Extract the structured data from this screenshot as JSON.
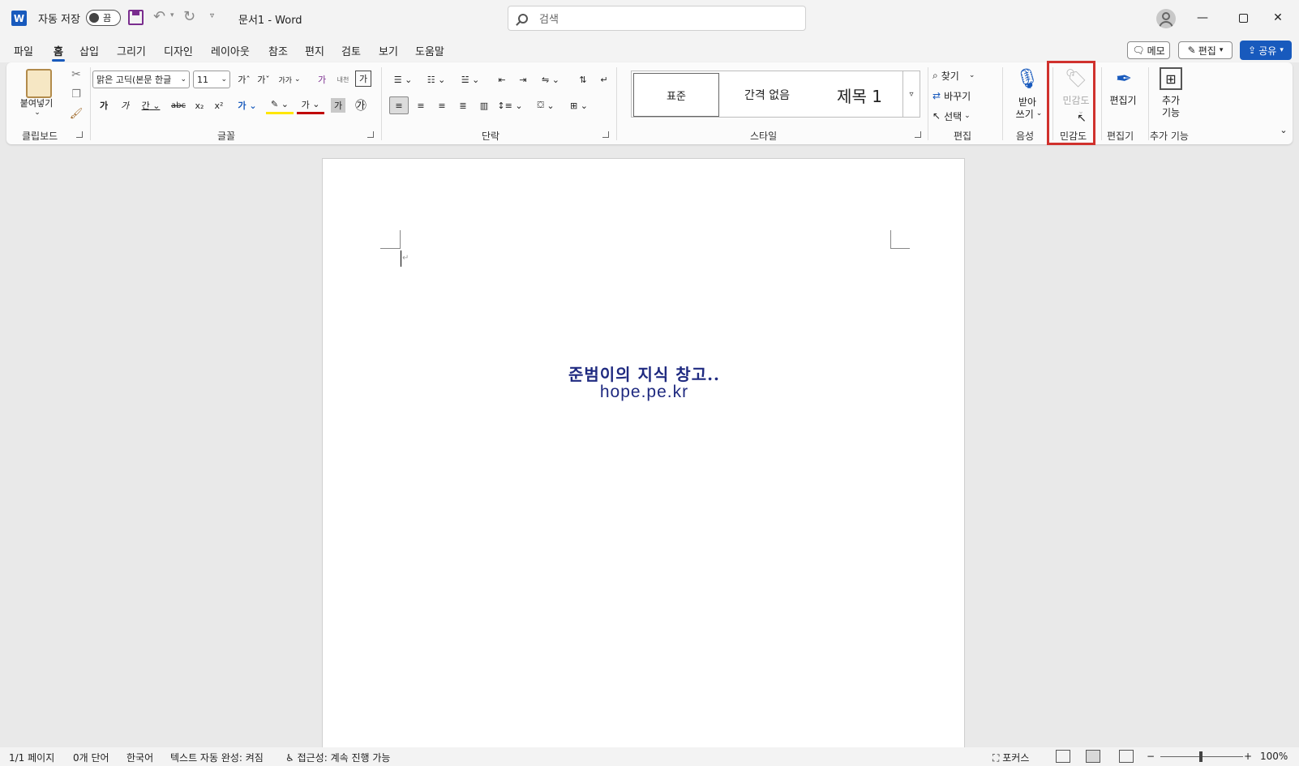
{
  "titlebar": {
    "app_icon": "W",
    "autosave_label": "자동 저장",
    "autosave_state": "끔",
    "doc_title": "문서1 - Word",
    "search_placeholder": "검색",
    "minimize": "—",
    "close": "✕"
  },
  "menu": {
    "tabs": [
      "파일",
      "홈",
      "삽입",
      "그리기",
      "디자인",
      "레이아웃",
      "참조",
      "편지",
      "검토",
      "보기",
      "도움말"
    ],
    "active": "홈",
    "memo": "메모",
    "edit": "편집",
    "share": "공유"
  },
  "ribbon": {
    "clipboard": {
      "label": "클립보드",
      "paste": "붙여넣기"
    },
    "font": {
      "label": "글꼴",
      "font_name": "맑은 고딕(본문 한글",
      "font_size": "11",
      "grow": "가ˆ",
      "shrink": "가ˇ",
      "case": "가가",
      "clear": "가",
      "phonetic": "내천",
      "border": "가",
      "bold": "가",
      "italic": "가",
      "underline": "간",
      "strike": "abc",
      "sub": "x₂",
      "sup": "x²",
      "effects": "가",
      "highlight": "✎",
      "color": "가",
      "shade": "가",
      "enclose": "㉮"
    },
    "paragraph": {
      "label": "단락"
    },
    "styles": {
      "label": "스타일",
      "items": [
        "표준",
        "간격 없음",
        "제목 1"
      ]
    },
    "editing": {
      "label": "편집",
      "find": "찾기",
      "replace": "바꾸기",
      "select": "선택"
    },
    "voice": {
      "label": "음성",
      "dictate_line1": "받아",
      "dictate_line2": "쓰기"
    },
    "sensitivity": {
      "label": "민감도",
      "button": "민감도"
    },
    "editor": {
      "label": "편집기",
      "button": "편집기"
    },
    "addins": {
      "label": "추가 기능",
      "line1": "추가",
      "line2": "기능"
    }
  },
  "document": {
    "line1": "준범이의 지식 창고..",
    "line2": "hope.pe.kr"
  },
  "status": {
    "page": "1/1 페이지",
    "words": "0개 단어",
    "language": "한국어",
    "autocomplete": "텍스트 자동 완성: 켜짐",
    "accessibility": "접근성: 계속 진행 가능",
    "focus": "포커스",
    "zoom_minus": "−",
    "zoom_plus": "+",
    "zoom": "100%"
  },
  "colors": {
    "accent": "#185abd",
    "highlight_box": "#d0312d",
    "doc_text": "#1f2a80"
  }
}
